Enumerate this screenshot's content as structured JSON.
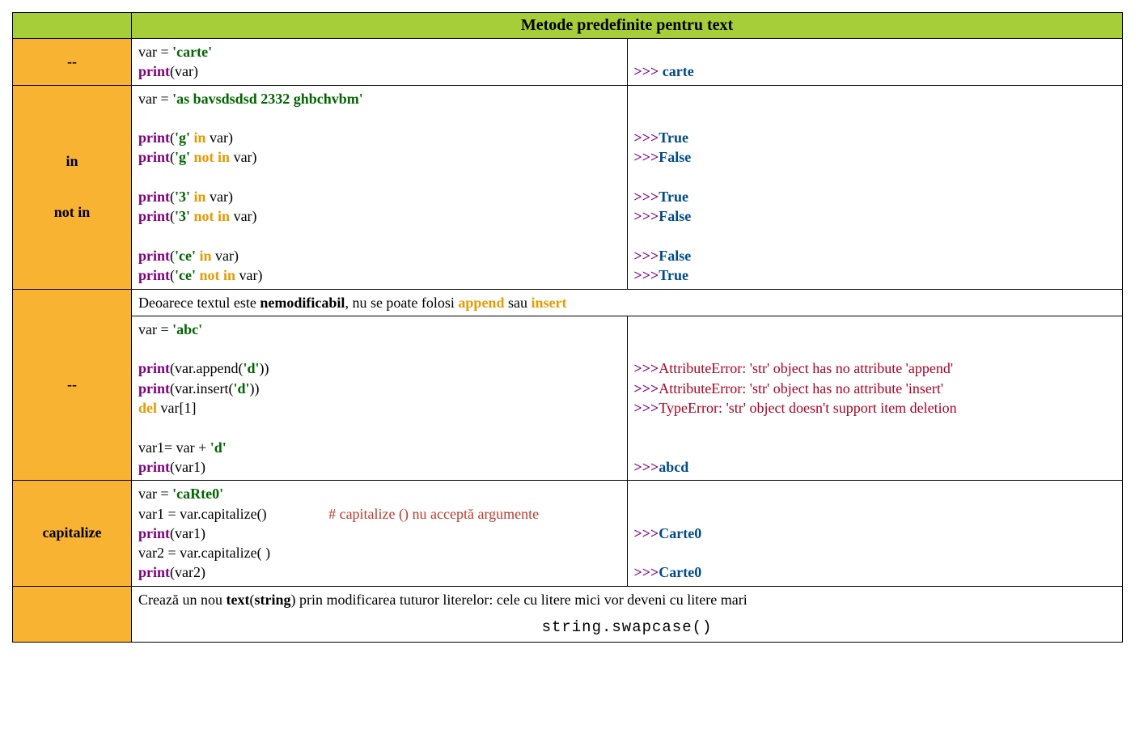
{
  "header": {
    "title": "Metode predefinite pentru text"
  },
  "row1": {
    "label": "--",
    "c_var": "var = ",
    "c_lit": "'carte'",
    "c_print": "print",
    "c_arg": "(var)",
    "o_prompt": ">>> ",
    "o_val": "carte"
  },
  "row2": {
    "label1": "in",
    "label2": "not in",
    "c_l0a": "var = ",
    "c_l0b": "'as bavsdsdsd 2332 ghbchvbm'",
    "print": "print",
    "g_s": "'g'",
    "g_in": " in ",
    "g_var": "var)",
    "g_nin": " not in ",
    "t3_s": "'3'",
    "ce_s": "'ce'",
    "o_t": "True",
    "o_f": "False",
    "p": ">>>"
  },
  "row3": {
    "label": "--",
    "note_a": "Deoarece textul este ",
    "note_b": "nemodificabil",
    "note_c": ", nu se poate folosi ",
    "note_append": "append",
    "note_d": " sau ",
    "note_insert": "insert",
    "c_l0a": "var = ",
    "c_l0b": "'abc'",
    "print": "print",
    "c_app_a": "(var.append(",
    "c_app_b": "'d'",
    "c_app_c": "))",
    "c_ins_a": "(var.insert(",
    "c_ins_b": "'d'",
    "c_ins_c": "))",
    "c_del_kw": "del",
    "c_del_rest": " var[1]",
    "c_cat_a": "var1= var + ",
    "c_cat_b": "'d'",
    "c_p1": "(var1)",
    "p": ">>>",
    "e1": "AttributeError: 'str' object has no attribute 'append'",
    "e2": "AttributeError: 'str' object has no attribute 'insert'",
    "e3": "TypeError: 'str' object doesn't support item deletion",
    "o_val": "abcd"
  },
  "row4": {
    "label": "capitalize",
    "c_l0a": "var = ",
    "c_l0b": "'caRte0'",
    "c_l1": "var1 = var.capitalize()",
    "c_cmt": "# capitalize () nu acceptă argumente",
    "print": "print",
    "c_p1": "(var1)",
    "c_l3": "var2 = var.capitalize(   )",
    "c_p2": "(var2)",
    "p": ">>>",
    "o": "Carte0"
  },
  "row5": {
    "t_a": "Crează un nou ",
    "t_b": "text",
    "t_c": "(",
    "t_d": "string",
    "t_e": ") prin modificarea tuturor literelor: cele cu litere mici vor deveni cu litere mari",
    "code": "string.swapcase()"
  }
}
